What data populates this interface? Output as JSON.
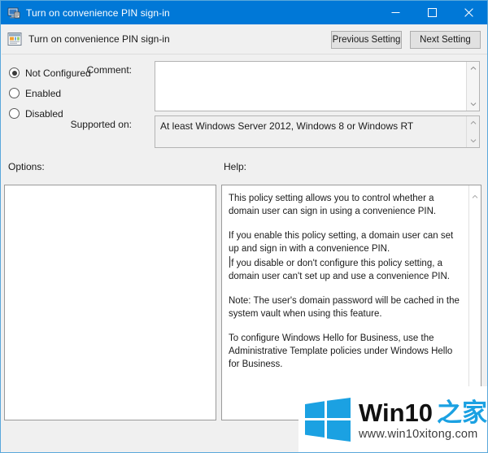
{
  "window": {
    "title": "Turn on convenience PIN sign-in",
    "icon": "policy-window-icon",
    "minimize_label": "Minimize",
    "maximize_label": "Maximize",
    "close_label": "Close",
    "border_color": "#5aa8db",
    "titlebar_color": "#0078d7"
  },
  "header": {
    "icon": "policy-setting-icon",
    "title": "Turn on convenience PIN sign-in",
    "previous_button": "Previous Setting",
    "next_button": "Next Setting"
  },
  "state_radios": [
    {
      "label": "Not Configured",
      "selected": true
    },
    {
      "label": "Enabled",
      "selected": false
    },
    {
      "label": "Disabled",
      "selected": false
    }
  ],
  "fields": {
    "comment_label": "Comment:",
    "comment_value": "",
    "supported_label": "Supported on:",
    "supported_value": "At least Windows Server 2012, Windows 8 or Windows RT"
  },
  "panels": {
    "options_label": "Options:",
    "options_content": "",
    "help_label": "Help:",
    "help_paragraphs": [
      "This policy setting allows you to control whether a domain user can sign in using a convenience PIN.",
      "If you enable this policy setting, a domain user can set up and sign in with a convenience PIN.",
      "If you disable or don't configure this policy setting, a domain user can't set up and use a convenience PIN.",
      "Note: The user's domain password will be cached in the system vault when using this feature.",
      "To configure Windows Hello for Business, use the Administrative Template policies under Windows Hello for Business."
    ]
  },
  "watermark": {
    "brand_en": "Win10",
    "brand_cn": "之家",
    "url": "www.win10xitong.com",
    "logo_color": "#1ba1e2"
  }
}
